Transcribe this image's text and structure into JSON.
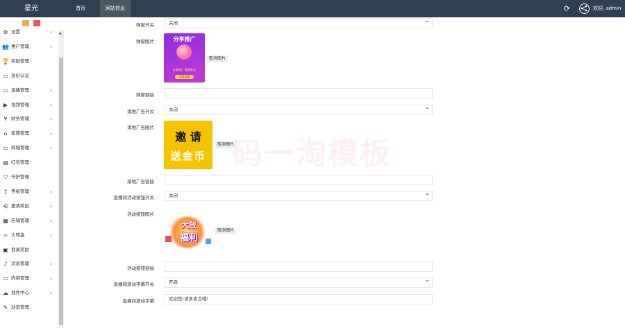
{
  "header": {
    "brand": "星光",
    "tabs": [
      {
        "label": "首页"
      },
      {
        "label": "网站信息"
      }
    ],
    "user": "欢迎, admin ▾"
  },
  "sidebar": {
    "items": [
      {
        "label": "设置",
        "icon": "gear-icon",
        "arrow": "›"
      },
      {
        "label": "用户管理",
        "icon": "users-icon",
        "arrow": "›"
      },
      {
        "label": "奖励管理",
        "icon": "trophy-icon",
        "arrow": ""
      },
      {
        "label": "身份认证",
        "icon": "id-card-icon",
        "arrow": ""
      },
      {
        "label": "直播管理",
        "icon": "monitor-icon",
        "arrow": "›"
      },
      {
        "label": "视频管理",
        "icon": "video-camera-icon",
        "arrow": "›"
      },
      {
        "label": "财务管理",
        "icon": "yen-icon",
        "arrow": "›"
      },
      {
        "label": "家族管理",
        "icon": "bank-icon",
        "arrow": "›"
      },
      {
        "label": "商城管理",
        "icon": "monitor-icon",
        "arrow": "›"
      },
      {
        "label": "红包管理",
        "icon": "red-packet-icon",
        "arrow": ""
      },
      {
        "label": "守护管理",
        "icon": "shield-icon",
        "arrow": ""
      },
      {
        "label": "等级管理",
        "icon": "level-icon",
        "arrow": "›"
      },
      {
        "label": "邀请奖励",
        "icon": "share-icon",
        "arrow": "›"
      },
      {
        "label": "店铺管理",
        "icon": "store-icon",
        "arrow": "›"
      },
      {
        "label": "大转盘",
        "icon": "wheel-icon",
        "arrow": "›"
      },
      {
        "label": "登录奖励",
        "icon": "gift-icon",
        "arrow": ""
      },
      {
        "label": "消息管理",
        "icon": "bell-icon",
        "arrow": "›"
      },
      {
        "label": "内容管理",
        "icon": "monitor-icon",
        "arrow": "›"
      },
      {
        "label": "插件中心",
        "icon": "cloud-icon",
        "arrow": "›"
      },
      {
        "label": "动态管理",
        "icon": "feed-icon",
        "arrow": ""
      }
    ]
  },
  "form": {
    "popup_switch": {
      "label": "弹窗开关",
      "value": "关闭"
    },
    "popup_image": {
      "label": "弹窗图片",
      "image_text_top": "分享推广",
      "image_text_mid": "分享推广·邀请有礼",
      "image_text_btn": "立即分享",
      "cancel": "取消图片"
    },
    "popup_link": {
      "label": "弹窗链接",
      "value": ""
    },
    "landing_switch": {
      "label": "落地广告开关",
      "value": "关闭"
    },
    "landing_image": {
      "label": "落地广告图片",
      "image_text_top": "邀 请",
      "image_text_bottom": "送金币",
      "cancel": "取消图片"
    },
    "landing_link": {
      "label": "落地广告链接",
      "value": ""
    },
    "live_btn_switch": {
      "label": "直播间活动按钮开关",
      "value": "关闭"
    },
    "activity_image": {
      "label": "活动按钮图片",
      "image_text_top": "大放",
      "image_text_bottom": "福利",
      "cancel": "取消图片"
    },
    "activity_link": {
      "label": "活动按钮链接",
      "value": ""
    },
    "marquee_switch": {
      "label": "直播间滚动字幕开关",
      "value": "开启"
    },
    "marquee_text": {
      "label": "直播间滚动字幕",
      "value": "欢迎您!请多发言哦!"
    }
  },
  "colors": {
    "topbar": "#2f4050",
    "warning": "#f0ad4e",
    "danger": "#ed5565"
  }
}
